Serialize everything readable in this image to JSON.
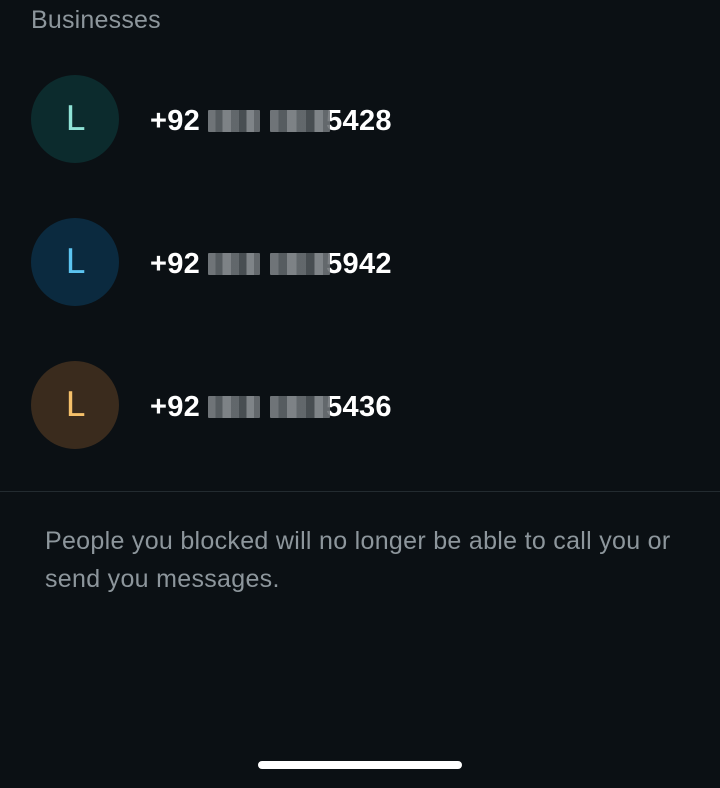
{
  "section": {
    "title": "Businesses"
  },
  "contacts": [
    {
      "initial": "L",
      "country_code": "+92",
      "number_suffix": "5428",
      "avatar_bg": "#0c2b2d",
      "avatar_fg": "#8fe3d6"
    },
    {
      "initial": "L",
      "country_code": "+92",
      "number_suffix": "5942",
      "avatar_bg": "#0b2a3f",
      "avatar_fg": "#5cc4f0"
    },
    {
      "initial": "L",
      "country_code": "+92",
      "number_suffix": "5436",
      "avatar_bg": "#3a2b1d",
      "avatar_fg": "#f5c06a"
    }
  ],
  "footer": {
    "info": "People you blocked will no longer be able to call you or send you messages."
  },
  "colors": {
    "background": "#0b1014",
    "secondary_text": "#8d969c",
    "primary_text": "#ffffff",
    "divider": "#232b30"
  }
}
